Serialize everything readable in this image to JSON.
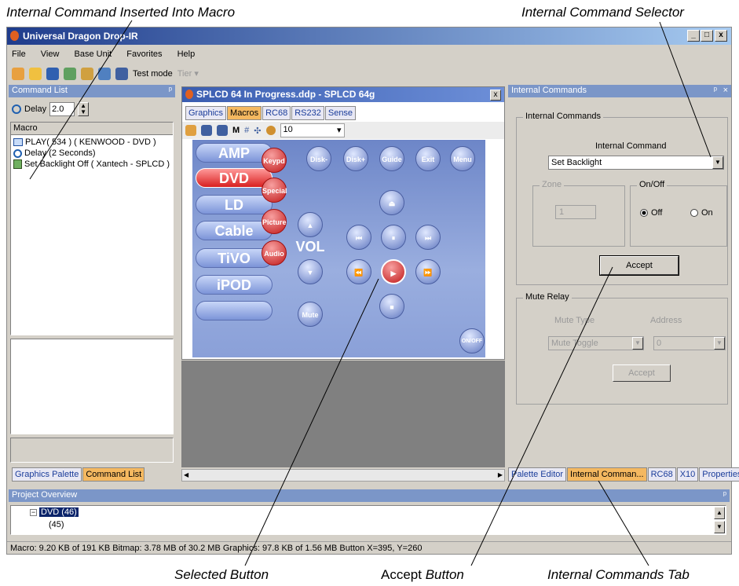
{
  "callouts": {
    "top_left": "Internal Command Inserted Into Macro",
    "top_right": "Internal Command Selector",
    "bottom_1": "Selected Button",
    "bottom_2a": "Accept",
    "bottom_2b": "Button",
    "bottom_3": "Internal Commands Tab"
  },
  "window": {
    "title": "Universal Dragon Drop-IR",
    "min": "_",
    "max": "□",
    "close": "x"
  },
  "menu": [
    "File",
    "View",
    "Base Unit",
    "Favorites",
    "Help"
  ],
  "toolbar": {
    "test_mode": "Test mode",
    "tier": "Tier"
  },
  "command_list": {
    "header": "Command List",
    "pin": "ⱼ",
    "delay_label": "Delay",
    "delay_value": "2.0",
    "column": "Macro",
    "items": [
      "PLAY( 534 ) ( KENWOOD - DVD )",
      "Delay (2 Seconds)",
      "Set Backlight Off ( Xantech - SPLCD )"
    ],
    "tabs": [
      "Graphics Palette",
      "Command List"
    ]
  },
  "doc": {
    "title": "SPLCD 64 In Progress.ddp - SPLCD 64g",
    "close": "x",
    "tabs": [
      "Graphics",
      "Macros",
      "RC68",
      "RS232",
      "Sense"
    ],
    "zoom": "10"
  },
  "remote": {
    "pills": [
      "AMP",
      "DVD",
      "LD",
      "Cable",
      "TiVO",
      "iPOD",
      ""
    ],
    "red": [
      "Keypd",
      "Special",
      "Picture",
      "Audio"
    ],
    "top_row": [
      "Disk-",
      "Disk+",
      "Guide",
      "Exit",
      "Menu"
    ],
    "vol": "VOL",
    "mute": "Mute",
    "onoff": "ON/OFF"
  },
  "internal": {
    "header": "Internal Commands",
    "group_title": "Internal Commands",
    "command_label": "Internal Command",
    "command_value": "Set Backlight",
    "zone_title": "Zone",
    "zone_value": "1",
    "onoff_title": "On/Off",
    "off": "Off",
    "on": "On",
    "accept": "Accept",
    "mute_title": "Mute Relay",
    "mute_type_label": "Mute Type",
    "address_label": "Address",
    "mute_type_value": "Mute Toggle",
    "address_value": "0",
    "accept2": "Accept",
    "tabs": [
      "Palette Editor",
      "Internal Comman...",
      "RC68",
      "X10",
      "Properties"
    ]
  },
  "project": {
    "header": "Project Overview",
    "node": "DVD (46)",
    "child": "(45)"
  },
  "status": "Macro: 9.20 KB of 191 KB  Bitmap: 3.78 MB of 30.2 MB  Graphics: 97.8 KB of 1.56 MB  Button  X=395, Y=260"
}
